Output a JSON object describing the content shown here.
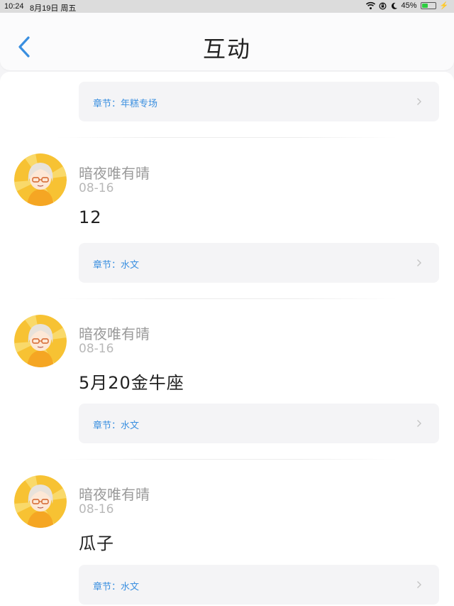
{
  "status": {
    "time": "10:24",
    "date": "8月19日 周五",
    "battery": "45%",
    "battery_level": 0.45
  },
  "header": {
    "title": "互动"
  },
  "feed": {
    "top_chapter": "章节：年糕专场",
    "posts": [
      {
        "username": "暗夜唯有晴",
        "date": "08-16",
        "content": "12",
        "chapter": "章节：水文"
      },
      {
        "username": "暗夜唯有晴",
        "date": "08-16",
        "content": "5月20金牛座",
        "chapter": "章节：水文"
      },
      {
        "username": "暗夜唯有晴",
        "date": "08-16",
        "content": "瓜子",
        "chapter": "章节：水文"
      }
    ]
  },
  "colors": {
    "accent": "#3a8fe0",
    "battery_green": "#2ecc40",
    "avatar_bg": "#f7c233"
  }
}
